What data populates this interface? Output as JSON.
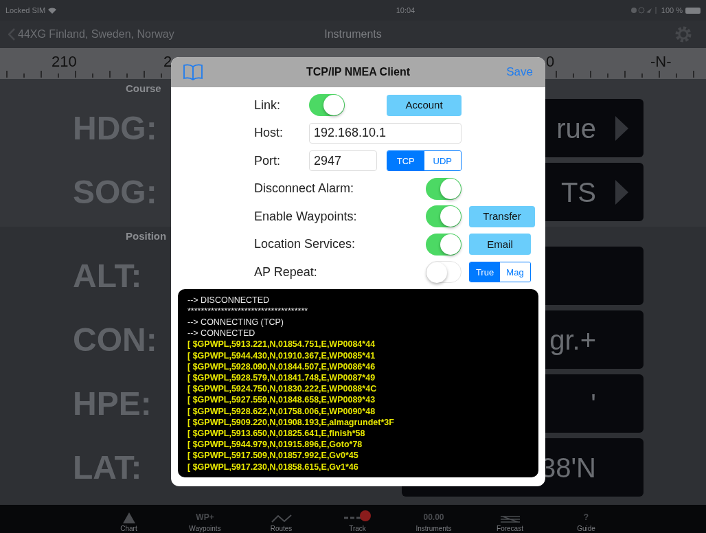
{
  "status_bar": {
    "carrier": "Locked SIM",
    "time": "10:04",
    "battery": "100 %"
  },
  "nav": {
    "back": "44XG Finland, Sweden, Norway",
    "title": "Instruments"
  },
  "compass": {
    "labels": [
      "210",
      "2",
      "0",
      "-N-"
    ]
  },
  "sections": [
    {
      "title": "Course",
      "rows": [
        {
          "label": "HDG:",
          "value": "rue",
          "arrow": true
        },
        {
          "label": "SOG:",
          "value": "TS",
          "arrow": true
        }
      ]
    },
    {
      "title": "Position",
      "rows": [
        {
          "label": "ALT:",
          "arrow": false
        },
        {
          "label": "CON:",
          "value": "gr.+",
          "arrow": false
        },
        {
          "label": "HPE:",
          "value": "'",
          "arrow": false
        },
        {
          "label": "LAT:",
          "value": "38'N",
          "arrow": false
        }
      ]
    }
  ],
  "tab_bar": [
    {
      "kind": "triangle",
      "label": "Chart"
    },
    {
      "kind": "glyph",
      "glyph": "WP+",
      "label": "Waypoints"
    },
    {
      "kind": "zigzag",
      "label": "Routes"
    },
    {
      "kind": "track",
      "label": "Track"
    },
    {
      "kind": "glyph",
      "glyph": "00.00",
      "label": "Instruments"
    },
    {
      "kind": "forecast",
      "label": "Forecast"
    },
    {
      "kind": "glyph",
      "glyph": "?",
      "label": "Guide"
    }
  ],
  "dialog": {
    "title": "TCP/IP NMEA Client",
    "save": "Save",
    "rows": [
      {
        "kind": "link",
        "label": "Link:",
        "on": true,
        "button": "Account"
      },
      {
        "kind": "field",
        "label": "Host:",
        "value": "192.168.10.1"
      },
      {
        "kind": "port",
        "label": "Port:",
        "value": "2947",
        "segments": [
          {
            "label": "TCP",
            "selected": true
          },
          {
            "label": "UDP",
            "selected": false
          }
        ]
      },
      {
        "kind": "toggle",
        "label": "Disconnect Alarm:",
        "on": true
      },
      {
        "kind": "toggle",
        "label": "Enable Waypoints:",
        "on": true,
        "button": "Transfer"
      },
      {
        "kind": "toggle",
        "label": "Location Services:",
        "on": true,
        "button": "Email"
      },
      {
        "kind": "toggle",
        "label": "AP Repeat:",
        "on": false,
        "segments": [
          {
            "label": "True",
            "selected": true
          },
          {
            "label": "Mag",
            "selected": false
          }
        ]
      }
    ],
    "console": [
      {
        "kind": "status",
        "text": "--> DISCONNECTED"
      },
      {
        "kind": "status",
        "text": "************************************"
      },
      {
        "kind": "status",
        "text": "--> CONNECTING (TCP)"
      },
      {
        "kind": "status",
        "text": "--> CONNECTED"
      },
      {
        "kind": "nmea",
        "text": "[ $GPWPL,5913.221,N,01854.751,E,WP0084*44"
      },
      {
        "kind": "nmea",
        "text": "[ $GPWPL,5944.430,N,01910.367,E,WP0085*41"
      },
      {
        "kind": "nmea",
        "text": "[ $GPWPL,5928.090,N,01844.507,E,WP0086*46"
      },
      {
        "kind": "nmea",
        "text": "[ $GPWPL,5928.579,N,01841.748,E,WP0087*49"
      },
      {
        "kind": "nmea",
        "text": "[ $GPWPL,5924.750,N,01830.222,E,WP0088*4C"
      },
      {
        "kind": "nmea",
        "text": "[ $GPWPL,5927.559,N,01848.658,E,WP0089*43"
      },
      {
        "kind": "nmea",
        "text": "[ $GPWPL,5928.622,N,01758.006,E,WP0090*48"
      },
      {
        "kind": "nmea",
        "text": "[ $GPWPL,5909.220,N,01908.193,E,almagrundet*3F"
      },
      {
        "kind": "nmea",
        "text": "[ $GPWPL,5913.650,N,01825.641,E,finish*58"
      },
      {
        "kind": "nmea",
        "text": "[ $GPWPL,5944.979,N,01915.896,E,Goto*78"
      },
      {
        "kind": "nmea",
        "text": "[ $GPWPL,5917.509,N,01857.992,E,Gv0*45"
      },
      {
        "kind": "nmea",
        "text": "[ $GPWPL,5917.230,N,01858.615,E,Gv1*46"
      }
    ]
  }
}
